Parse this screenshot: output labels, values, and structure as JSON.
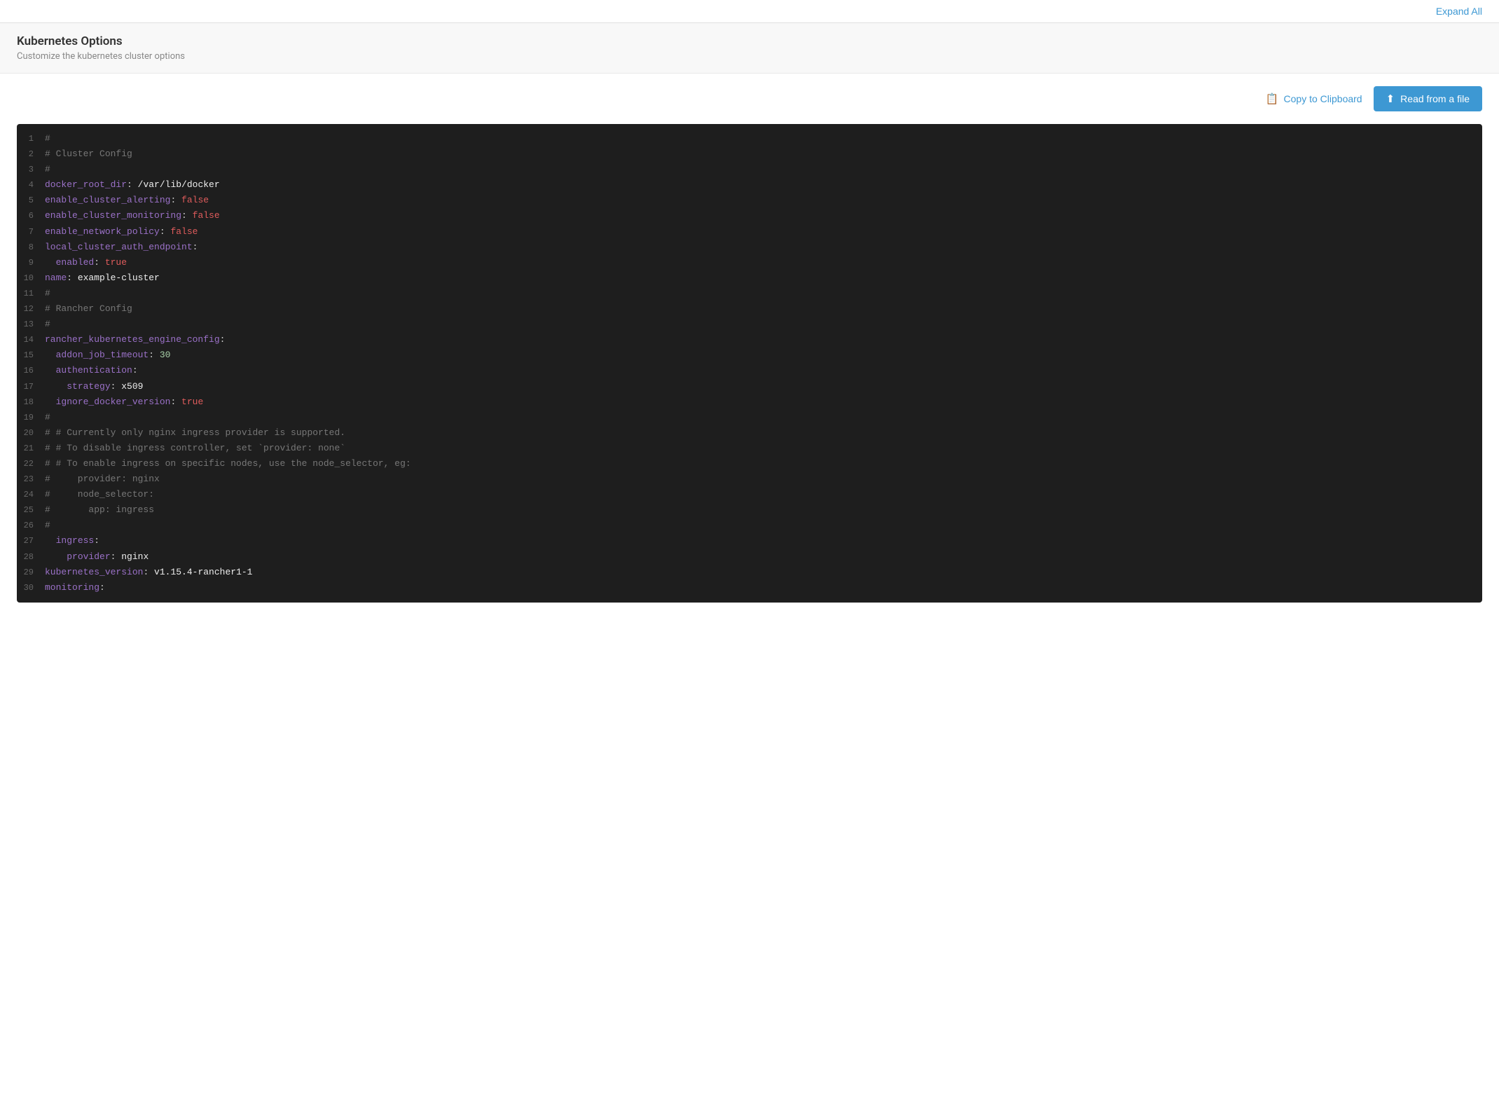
{
  "topBar": {
    "expandAll": "Expand All"
  },
  "header": {
    "title": "Kubernetes Options",
    "subtitle": "Customize the kubernetes cluster options"
  },
  "toolbar": {
    "copyLabel": "Copy to Clipboard",
    "readFileLabel": "Read from a file"
  },
  "codeLines": [
    {
      "num": 1,
      "tokens": [
        {
          "t": "comment",
          "v": "#"
        }
      ]
    },
    {
      "num": 2,
      "tokens": [
        {
          "t": "comment",
          "v": "# Cluster Config"
        }
      ]
    },
    {
      "num": 3,
      "tokens": [
        {
          "t": "comment",
          "v": "#"
        }
      ]
    },
    {
      "num": 4,
      "tokens": [
        {
          "t": "key",
          "v": "docker_root_dir"
        },
        {
          "t": "colon",
          "v": ": "
        },
        {
          "t": "value-white",
          "v": "/var/lib/docker"
        }
      ]
    },
    {
      "num": 5,
      "tokens": [
        {
          "t": "key",
          "v": "enable_cluster_alerting"
        },
        {
          "t": "colon",
          "v": ": "
        },
        {
          "t": "value-false",
          "v": "false"
        }
      ]
    },
    {
      "num": 6,
      "tokens": [
        {
          "t": "key",
          "v": "enable_cluster_monitoring"
        },
        {
          "t": "colon",
          "v": ": "
        },
        {
          "t": "value-false",
          "v": "false"
        }
      ]
    },
    {
      "num": 7,
      "tokens": [
        {
          "t": "key",
          "v": "enable_network_policy"
        },
        {
          "t": "colon",
          "v": ": "
        },
        {
          "t": "value-false",
          "v": "false"
        }
      ]
    },
    {
      "num": 8,
      "tokens": [
        {
          "t": "key",
          "v": "local_cluster_auth_endpoint"
        },
        {
          "t": "colon",
          "v": ":"
        }
      ]
    },
    {
      "num": 9,
      "tokens": [
        {
          "t": "indent",
          "v": "  "
        },
        {
          "t": "key",
          "v": "enabled"
        },
        {
          "t": "colon",
          "v": ": "
        },
        {
          "t": "value-true",
          "v": "true"
        }
      ]
    },
    {
      "num": 10,
      "tokens": [
        {
          "t": "key",
          "v": "name"
        },
        {
          "t": "colon",
          "v": ": "
        },
        {
          "t": "value-white",
          "v": "example-cluster"
        }
      ]
    },
    {
      "num": 11,
      "tokens": [
        {
          "t": "comment",
          "v": "#"
        }
      ]
    },
    {
      "num": 12,
      "tokens": [
        {
          "t": "comment",
          "v": "# Rancher Config"
        }
      ]
    },
    {
      "num": 13,
      "tokens": [
        {
          "t": "comment",
          "v": "#"
        }
      ]
    },
    {
      "num": 14,
      "tokens": [
        {
          "t": "key",
          "v": "rancher_kubernetes_engine_config"
        },
        {
          "t": "colon",
          "v": ":"
        }
      ]
    },
    {
      "num": 15,
      "tokens": [
        {
          "t": "indent",
          "v": "  "
        },
        {
          "t": "key",
          "v": "addon_job_timeout"
        },
        {
          "t": "colon",
          "v": ": "
        },
        {
          "t": "value-num",
          "v": "30"
        }
      ]
    },
    {
      "num": 16,
      "tokens": [
        {
          "t": "indent",
          "v": "  "
        },
        {
          "t": "key",
          "v": "authentication"
        },
        {
          "t": "colon",
          "v": ":"
        }
      ]
    },
    {
      "num": 17,
      "tokens": [
        {
          "t": "indent",
          "v": "    "
        },
        {
          "t": "key",
          "v": "strategy"
        },
        {
          "t": "colon",
          "v": ": "
        },
        {
          "t": "value-white",
          "v": "x509"
        }
      ]
    },
    {
      "num": 18,
      "tokens": [
        {
          "t": "indent",
          "v": "  "
        },
        {
          "t": "key",
          "v": "ignore_docker_version"
        },
        {
          "t": "colon",
          "v": ": "
        },
        {
          "t": "value-true",
          "v": "true"
        }
      ]
    },
    {
      "num": 19,
      "tokens": [
        {
          "t": "comment",
          "v": "#"
        }
      ]
    },
    {
      "num": 20,
      "tokens": [
        {
          "t": "comment",
          "v": "# # Currently only nginx ingress provider is supported."
        }
      ]
    },
    {
      "num": 21,
      "tokens": [
        {
          "t": "comment",
          "v": "# # To disable ingress controller, set `provider: none`"
        }
      ]
    },
    {
      "num": 22,
      "tokens": [
        {
          "t": "comment",
          "v": "# # To enable ingress on specific nodes, use the node_selector, eg:"
        }
      ]
    },
    {
      "num": 23,
      "tokens": [
        {
          "t": "comment",
          "v": "#     provider: nginx"
        }
      ]
    },
    {
      "num": 24,
      "tokens": [
        {
          "t": "comment",
          "v": "#     node_selector:"
        }
      ]
    },
    {
      "num": 25,
      "tokens": [
        {
          "t": "comment",
          "v": "#       app: ingress"
        }
      ]
    },
    {
      "num": 26,
      "tokens": [
        {
          "t": "comment",
          "v": "#"
        }
      ]
    },
    {
      "num": 27,
      "tokens": [
        {
          "t": "indent",
          "v": "  "
        },
        {
          "t": "key",
          "v": "ingress"
        },
        {
          "t": "colon",
          "v": ":"
        }
      ]
    },
    {
      "num": 28,
      "tokens": [
        {
          "t": "indent",
          "v": "    "
        },
        {
          "t": "key",
          "v": "provider"
        },
        {
          "t": "colon",
          "v": ": "
        },
        {
          "t": "value-white",
          "v": "nginx"
        }
      ]
    },
    {
      "num": 29,
      "tokens": [
        {
          "t": "key",
          "v": "kubernetes_version"
        },
        {
          "t": "colon",
          "v": ": "
        },
        {
          "t": "value-white",
          "v": "v1.15.4-rancher1-1"
        }
      ]
    },
    {
      "num": 30,
      "tokens": [
        {
          "t": "key",
          "v": "monitoring"
        },
        {
          "t": "colon",
          "v": ":"
        }
      ]
    }
  ]
}
